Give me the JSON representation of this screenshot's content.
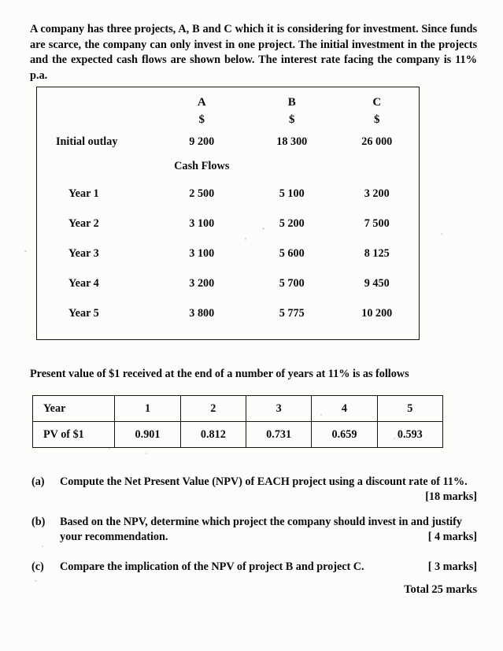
{
  "document": {
    "intro_paragraph": "A company has three projects, A, B and C which it is considering for investment.  Since funds are scarce, the company can only invest in one project.  The initial investment in the projects and the expected cash flows are shown below. The interest rate facing the company is 11% p.a.",
    "pv_sentence": "Present value of $1 received at the end of a number of years at 11% is as follows",
    "total_marks": "Total 25 marks"
  },
  "cash_flow_table": {
    "column_headers": [
      "A",
      "B",
      "C"
    ],
    "currency_symbols": [
      "$",
      "$",
      "$"
    ],
    "initial_outlay_label": "Initial outlay",
    "initial_outlay_values": [
      "9 200",
      "18 300",
      "26 000"
    ],
    "cash_flows_label": "Cash Flows",
    "rows": [
      {
        "label": "Year 1",
        "values": [
          "2 500",
          "5 100",
          "3 200"
        ]
      },
      {
        "label": "Year 2",
        "values": [
          "3 100",
          "5 200",
          "7 500"
        ]
      },
      {
        "label": "Year 3",
        "values": [
          "3 100",
          "5 600",
          "8 125"
        ]
      },
      {
        "label": "Year 4",
        "values": [
          "3 200",
          "5 700",
          "9 450"
        ]
      },
      {
        "label": "Year 5",
        "values": [
          "3 800",
          "5 775",
          "10 200"
        ]
      }
    ]
  },
  "pv_table": {
    "year_row_label": "Year",
    "years": [
      "1",
      "2",
      "3",
      "4",
      "5"
    ],
    "pv_row_label": "PV of $1",
    "pv_factors": [
      "0.901",
      "0.812",
      "0.731",
      "0.659",
      "0.593"
    ]
  },
  "questions": [
    {
      "letter": "(a)",
      "text": "Compute the Net Present Value (NPV) of EACH project using a discount rate of 11%.",
      "marks": "[18 marks]"
    },
    {
      "letter": "(b)",
      "text": "Based on the NPV, determine which project the company should invest in and justify",
      "text_line2": "your recommendation.",
      "marks": "[ 4 marks]"
    },
    {
      "letter": "(c)",
      "text": "Compare the implication of the NPV of project B and project C.",
      "marks": "[ 3 marks]"
    }
  ],
  "chart_data": {
    "type": "table",
    "title": "Project cash flows and PV factors at 11%",
    "categories": [
      "Initial outlay",
      "Year 1",
      "Year 2",
      "Year 3",
      "Year 4",
      "Year 5"
    ],
    "series": [
      {
        "name": "A",
        "values": [
          9200,
          2500,
          3100,
          3100,
          3200,
          3800
        ]
      },
      {
        "name": "B",
        "values": [
          18300,
          5100,
          5200,
          5600,
          5700,
          5775
        ]
      },
      {
        "name": "C",
        "values": [
          26000,
          3200,
          7500,
          8125,
          9450,
          10200
        ]
      }
    ],
    "pv_factors": {
      "x": [
        1,
        2,
        3,
        4,
        5
      ],
      "values": [
        0.901,
        0.812,
        0.731,
        0.659,
        0.593
      ]
    },
    "discount_rate_percent": 11,
    "xlabel": "Year",
    "ylabel": "Cash flow ($)"
  }
}
